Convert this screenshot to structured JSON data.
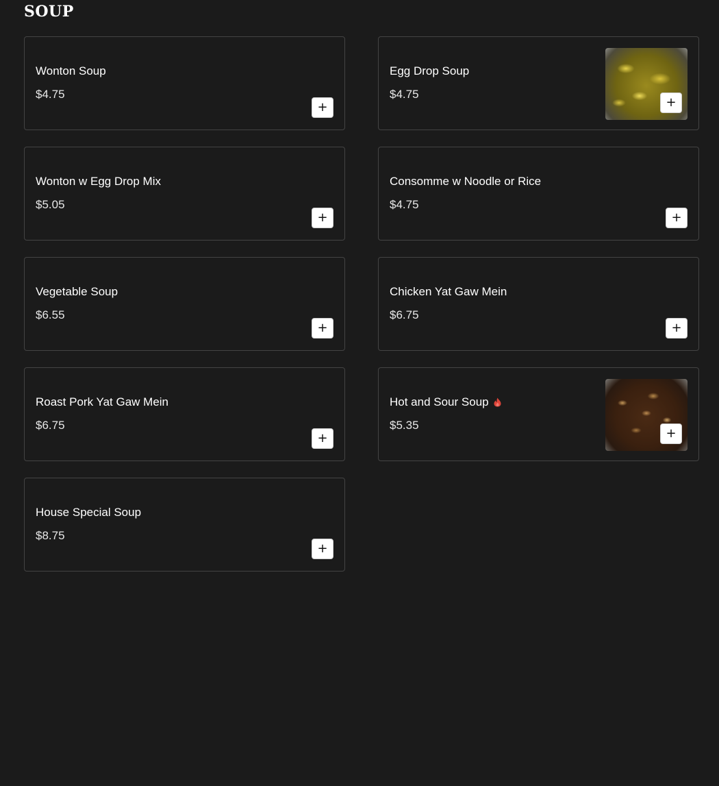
{
  "section": {
    "title": "SOUP"
  },
  "items": [
    {
      "name": "Wonton Soup",
      "price": "$4.75",
      "add_label": "+"
    },
    {
      "name": "Egg Drop Soup",
      "price": "$4.75",
      "add_label": "+",
      "image": "egg-drop-soup-photo"
    },
    {
      "name": "Wonton w Egg Drop Mix",
      "price": "$5.05",
      "add_label": "+"
    },
    {
      "name": "Consomme w Noodle or Rice",
      "price": "$4.75",
      "add_label": "+"
    },
    {
      "name": "Vegetable Soup",
      "price": "$6.55",
      "add_label": "+"
    },
    {
      "name": "Chicken Yat Gaw Mein",
      "price": "$6.75",
      "add_label": "+"
    },
    {
      "name": "Roast Pork Yat Gaw Mein",
      "price": "$6.75",
      "add_label": "+"
    },
    {
      "name": "Hot and Sour Soup",
      "price": "$5.35",
      "add_label": "+",
      "image": "hot-and-sour-soup-photo",
      "badge_icon": "spicy-icon"
    },
    {
      "name": "House Special Soup",
      "price": "$8.75",
      "add_label": "+"
    }
  ],
  "colors": {
    "background": "#1b1b1b",
    "card_border": "#444444",
    "text": "#ffffff",
    "spicy": "#e0453a",
    "button_bg": "#ffffff"
  }
}
